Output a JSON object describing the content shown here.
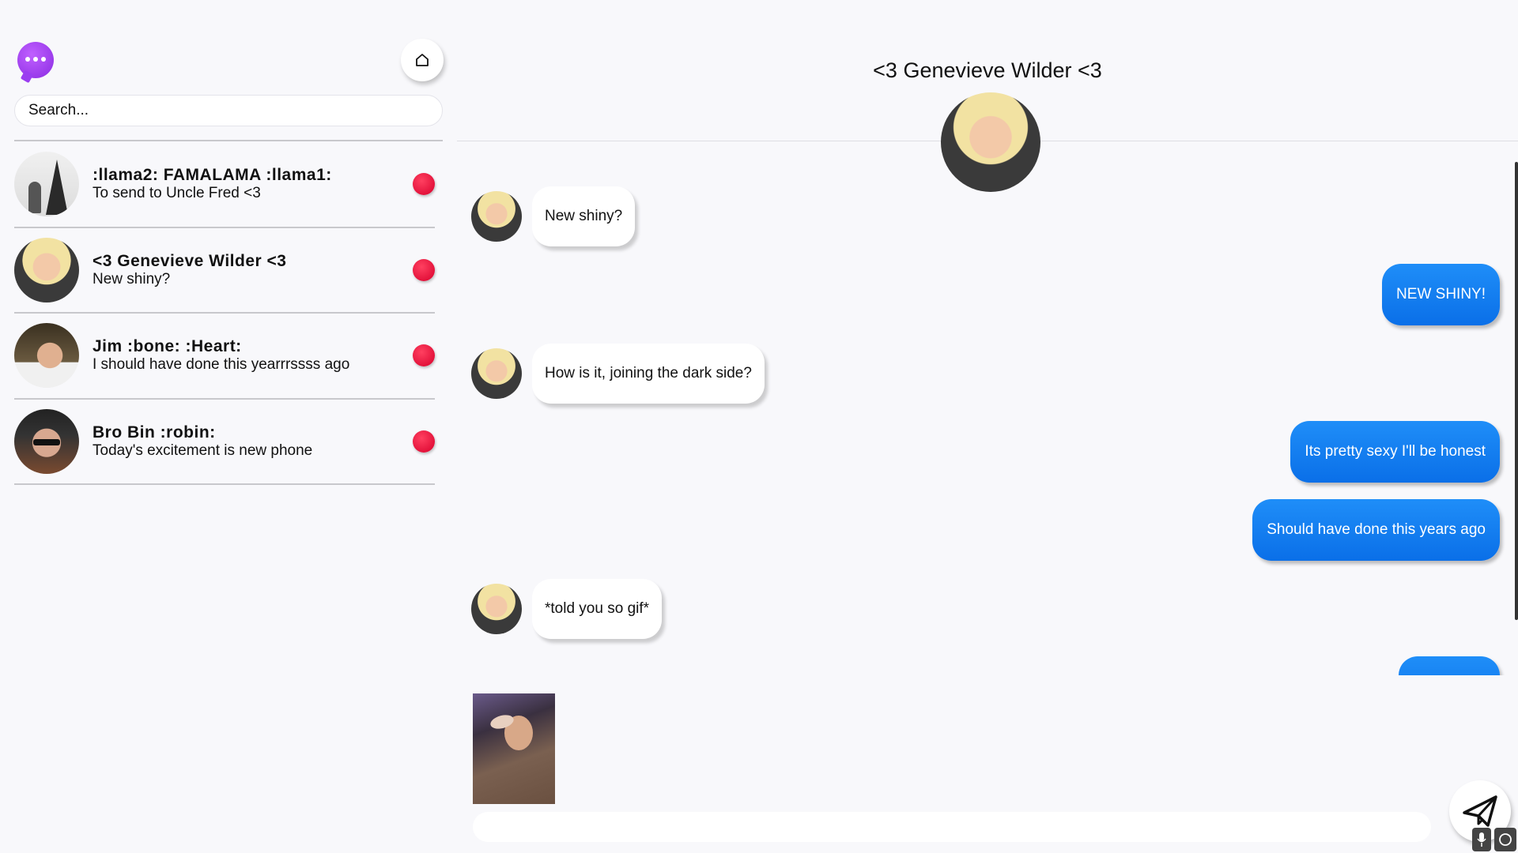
{
  "app": {
    "logo_icon": "chat-bubble-icon",
    "brand_color": "#9b3ef0"
  },
  "sidebar": {
    "home_icon": "home-icon",
    "search": {
      "placeholder": "Search...",
      "value": ""
    },
    "conversations": [
      {
        "name": ":llama2: FAMALAMA :llama1:",
        "preview": "To send to Uncle Fred <3",
        "unread": true
      },
      {
        "name": "<3 Genevieve Wilder <3",
        "preview": "New shiny?",
        "unread": true
      },
      {
        "name": "Jim :bone: :Heart:",
        "preview": "I should have done this yearrrssss ago",
        "unread": true
      },
      {
        "name": "Bro Bin :robin:",
        "preview": "Today's excitement is new phone",
        "unread": true
      }
    ],
    "unread_color": "#e0103c"
  },
  "chat": {
    "title": "<3 Genevieve Wilder <3",
    "messages": [
      {
        "direction": "in",
        "text": "New shiny?"
      },
      {
        "direction": "out",
        "text": "NEW SHINY!"
      },
      {
        "direction": "in",
        "text": "How is it, joining the dark side?"
      },
      {
        "direction": "out",
        "text": "Its pretty sexy I'll be honest"
      },
      {
        "direction": "out",
        "text": "Should have done this years ago"
      },
      {
        "direction": "in",
        "text": "*told you so gif*"
      },
      {
        "direction": "out",
        "text": ""
      }
    ],
    "outgoing_color": "#1083f5",
    "composer": {
      "placeholder": "",
      "value": ""
    },
    "send_icon": "send-icon",
    "mic_icon": "mic-icon"
  }
}
